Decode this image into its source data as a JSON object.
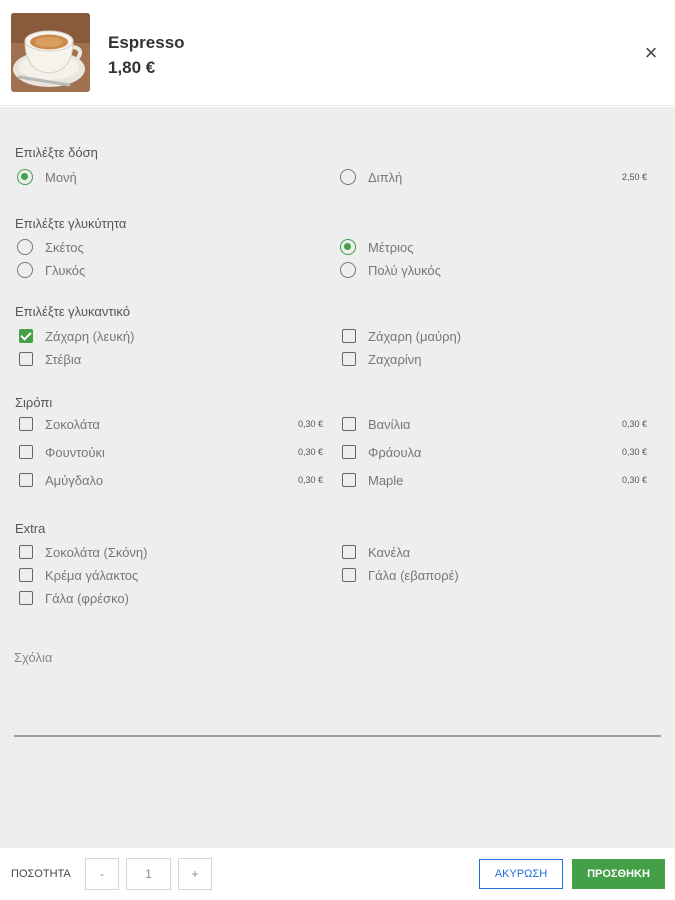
{
  "product": {
    "name": "Espresso",
    "price": "1,80 €"
  },
  "dose": {
    "title": "Επιλέξτε δόση",
    "options": [
      {
        "label": "Μονή",
        "selected": true,
        "extra_price": ""
      },
      {
        "label": "Διπλή",
        "selected": false,
        "extra_price": "2,50 €"
      }
    ]
  },
  "sweetness": {
    "title": "Επιλέξτε γλυκύτητα",
    "options": [
      {
        "label": "Σκέτος",
        "selected": false
      },
      {
        "label": "Μέτριος",
        "selected": true
      },
      {
        "label": "Γλυκός",
        "selected": false
      },
      {
        "label": "Πολύ γλυκός",
        "selected": false
      }
    ]
  },
  "sweetener": {
    "title": "Επιλέξτε γλυκαντικό",
    "options": [
      {
        "label": "Ζάχαρη (λευκή)",
        "checked": true
      },
      {
        "label": "Ζάχαρη (μαύρη)",
        "checked": false
      },
      {
        "label": "Στέβια",
        "checked": false
      },
      {
        "label": "Ζαχαρίνη",
        "checked": false
      }
    ]
  },
  "syrup": {
    "title": "Σιρόπι",
    "options": [
      {
        "label": "Σοκολάτα",
        "checked": false,
        "extra_price": "0,30 €"
      },
      {
        "label": "Βανίλια",
        "checked": false,
        "extra_price": "0,30 €"
      },
      {
        "label": "Φουντούκι",
        "checked": false,
        "extra_price": "0,30 €"
      },
      {
        "label": "Φράουλα",
        "checked": false,
        "extra_price": "0,30 €"
      },
      {
        "label": "Αμύγδαλο",
        "checked": false,
        "extra_price": "0,30 €"
      },
      {
        "label": "Maple",
        "checked": false,
        "extra_price": "0,30 €"
      }
    ]
  },
  "extra": {
    "title": "Extra",
    "options": [
      {
        "label": "Σοκολάτα (Σκόνη)",
        "checked": false
      },
      {
        "label": "Κανέλα",
        "checked": false
      },
      {
        "label": "Κρέμα γάλακτος",
        "checked": false
      },
      {
        "label": "Γάλα (εβαπορέ)",
        "checked": false
      },
      {
        "label": "Γάλα (φρέσκο)",
        "checked": false
      }
    ]
  },
  "comments": {
    "placeholder": "Σχόλια"
  },
  "footer": {
    "quantity_label": "ΠΟΣΟΤΗΤΑ",
    "minus": "-",
    "quantity": "1",
    "plus": "+",
    "cancel_label": "ΑΚΥΡΩΣΗ",
    "add_label": "ΠΡΟΣΘΗΚΗ"
  },
  "colors": {
    "accent_green": "#43a047",
    "cancel_blue": "#1e6fd9",
    "panel_bg": "#eeeeee"
  },
  "icons": {
    "close": "close-icon",
    "product_image": "espresso-cup-image"
  }
}
